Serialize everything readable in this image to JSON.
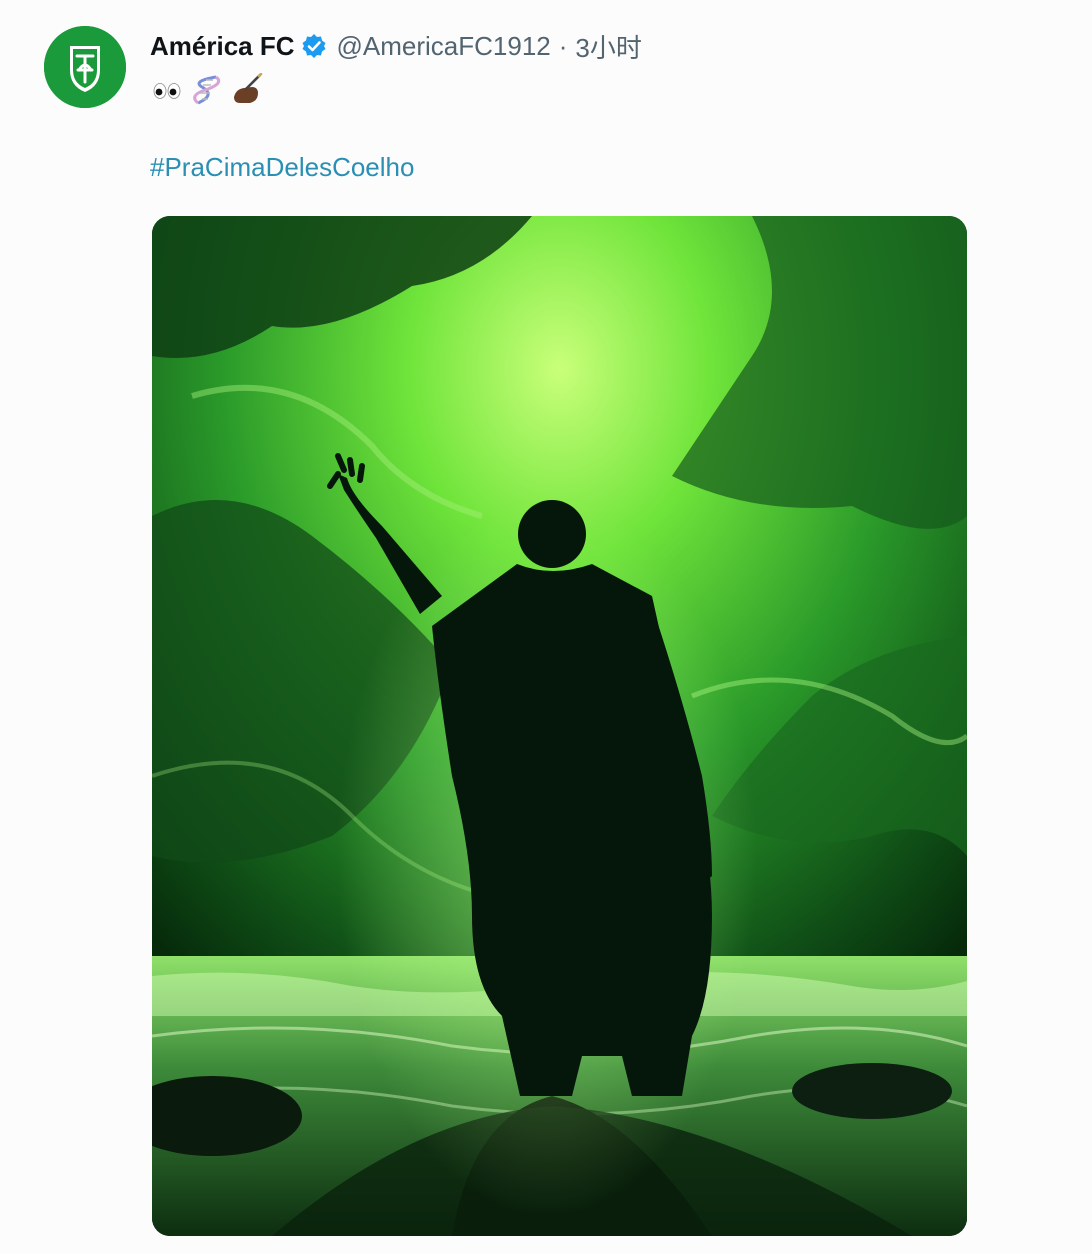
{
  "tweet": {
    "author_name": "América FC",
    "author_handle": "@AmericaFC1912",
    "separator": "·",
    "timestamp": "3小时",
    "emojis": [
      "eyes-icon",
      "dna-icon",
      "writing-hand-icon"
    ],
    "hashtag": "#PraCimaDelesCoelho",
    "avatar_icon": "america-fc-crest-icon",
    "verified_icon": "verified-badge-icon",
    "media": {
      "description_icon": "green-sky-figure-image"
    }
  },
  "colors": {
    "name": "#0f1419",
    "handle": "#536471",
    "hashtag": "#2a8fb3",
    "verified": "#1d9bf0",
    "avatar_bg": "#1a9a3a",
    "media_glow": "#7cf04a"
  }
}
